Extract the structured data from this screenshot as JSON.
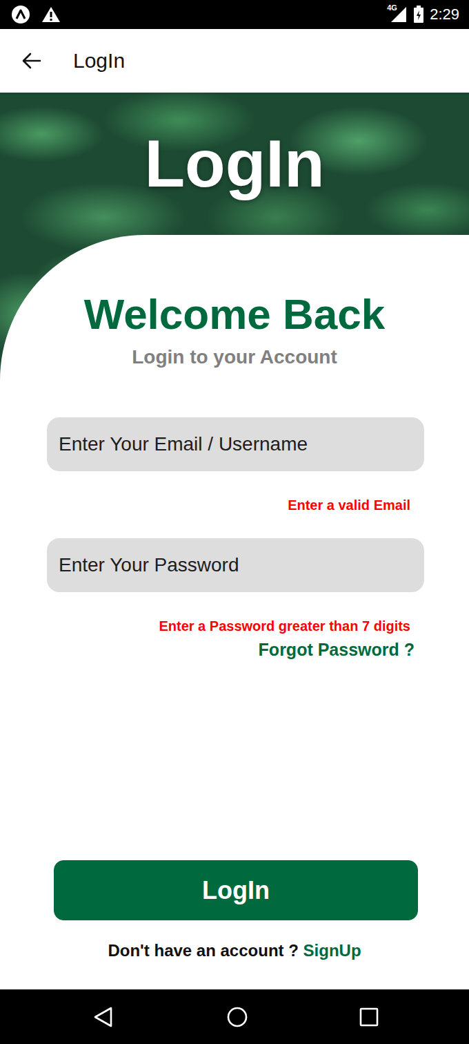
{
  "status_bar": {
    "network": "4G",
    "time": "2:29"
  },
  "app_bar": {
    "title": "LogIn"
  },
  "hero": {
    "title": "LogIn"
  },
  "form": {
    "heading": "Welcome Back",
    "subheading": "Login to your Account",
    "fields": [
      {
        "placeholder": "Enter Your Email / Username",
        "error": "Enter a valid Email",
        "kind": "text"
      },
      {
        "placeholder": "Enter Your Password",
        "error": "Enter a Password greater than 7 digits",
        "kind": "password"
      }
    ],
    "forgot_link": "Forgot Password ?",
    "submit": "LogIn",
    "footer_prompt": "Don't have an account ?",
    "footer_link": "SignUp"
  }
}
